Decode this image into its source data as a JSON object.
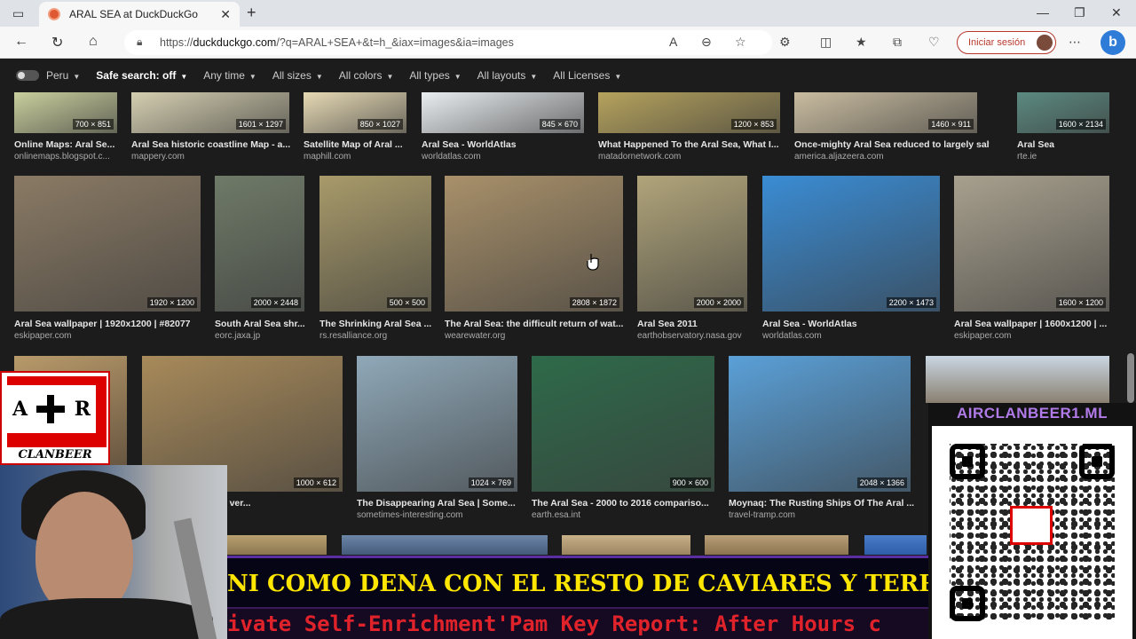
{
  "browser": {
    "tab_title": "ARAL SEA at DuckDuckGo",
    "url_prefix": "https://",
    "url_host": "duckduckgo.com",
    "url_path": "/?q=ARAL+SEA+&t=h_&iax=images&ia=images",
    "signin_label": "Iniciar sesión"
  },
  "filters": {
    "region": "Peru",
    "safe_search": "Safe search: off",
    "time": "Any time",
    "sizes": "All sizes",
    "colors": "All colors",
    "types": "All types",
    "layouts": "All layouts",
    "licenses": "All Licenses"
  },
  "results": {
    "row1": [
      {
        "title": "Online Maps: Aral Se...",
        "source": "onlinemaps.blogspot.c...",
        "dims": "700 × 851"
      },
      {
        "title": "Aral Sea historic coastline Map - a...",
        "source": "mappery.com",
        "dims": "1601 × 1297"
      },
      {
        "title": "Satellite Map of Aral ...",
        "source": "maphill.com",
        "dims": "850 × 1027"
      },
      {
        "title": "Aral Sea - WorldAtlas",
        "source": "worldatlas.com",
        "dims": "845 × 670"
      },
      {
        "title": "What Happened To the Aral Sea, What I...",
        "source": "matadornetwork.com",
        "dims": "1200 × 853"
      },
      {
        "title": "Once-mighty Aral Sea reduced to largely salt ...",
        "source": "america.aljazeera.com",
        "dims": "1460 × 911"
      },
      {
        "title": "Aral Sea",
        "source": "rte.ie",
        "dims": "1600 × 2134"
      }
    ],
    "row2": [
      {
        "title": "Aral Sea wallpaper | 1920x1200 | #82077",
        "source": "eskipaper.com",
        "dims": "1920 × 1200"
      },
      {
        "title": "South Aral Sea shr...",
        "source": "eorc.jaxa.jp",
        "dims": "2000 × 2448"
      },
      {
        "title": "The Shrinking Aral Sea ...",
        "source": "rs.resalliance.org",
        "dims": "500 × 500"
      },
      {
        "title": "The Aral Sea: the difficult return of wat...",
        "source": "wearewater.org",
        "dims": "2808 × 1872"
      },
      {
        "title": "Aral Sea 2011",
        "source": "earthobservatory.nasa.gov",
        "dims": "2000 × 2000"
      },
      {
        "title": "Aral Sea - WorldAtlas",
        "source": "worldatlas.com",
        "dims": "2200 × 1473"
      },
      {
        "title": "Aral Sea wallpaper | 1600x1200 | ...",
        "source": "eskipaper.com",
        "dims": "1600 × 1200"
      }
    ],
    "row3": [
      {
        "title": "dries up before our ver...",
        "source": "",
        "dims": "1000 × 612"
      },
      {
        "title": "The Disappearing Aral Sea | Some...",
        "source": "sometimes-interesting.com",
        "dims": "1024 × 769"
      },
      {
        "title": "The Aral Sea - 2000 to 2016 compariso...",
        "source": "earth.esa.int",
        "dims": "900 × 600"
      },
      {
        "title": "Moynaq: The Rusting Ships Of The Aral ...",
        "source": "travel-tramp.com",
        "dims": "2048 × 1366"
      }
    ]
  },
  "overlays": {
    "logo_left": "A",
    "logo_right": "R",
    "logo_caption": "CLANBEER",
    "qr_label": "AIRCLANBEER1.ML",
    "ticker_top": "NI COMO DENA CON EL RESTO DE CAVIARES Y TERRO",
    "ticker_bottom": "ivate Self-Enrichment'Pam Key Report: After Hours c"
  }
}
